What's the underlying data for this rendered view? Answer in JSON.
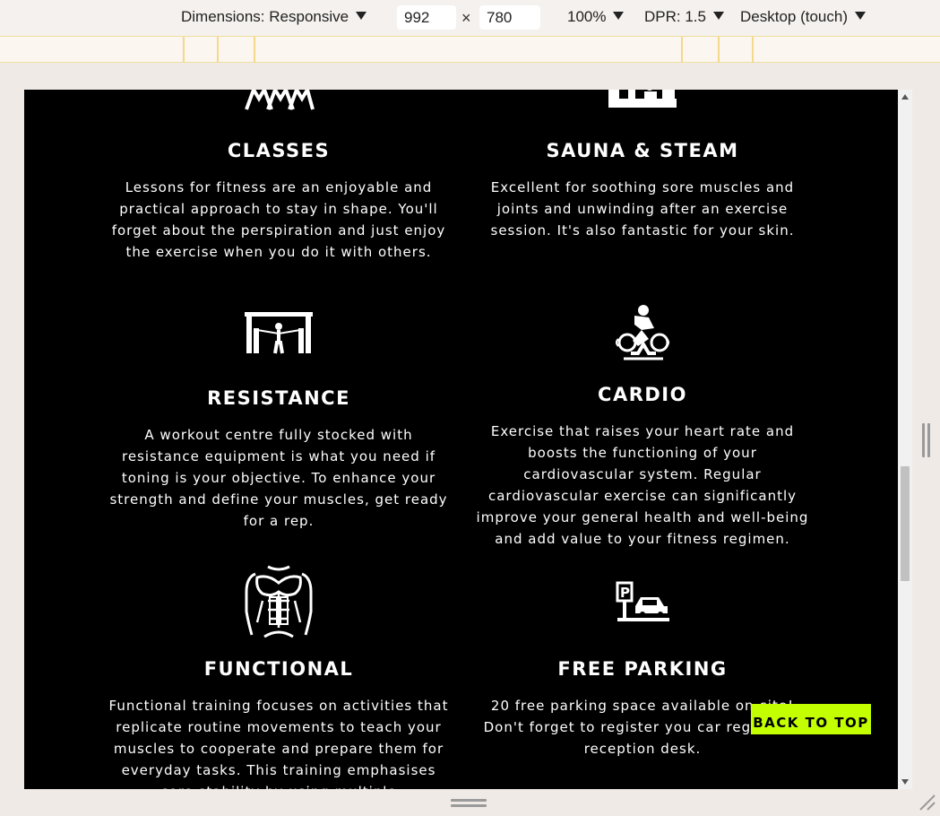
{
  "devtools": {
    "dimensions_label": "Dimensions: Responsive",
    "width_value": "992",
    "times_symbol": "×",
    "height_value": "780",
    "zoom": "100%",
    "dpr": "DPR: 1.5",
    "device_mode": "Desktop (touch)"
  },
  "features": [
    {
      "title": "CLASSES",
      "icon": "group-exercise-icon",
      "description": "Lessons for fitness are an enjoyable and practical approach to stay in shape. You'll forget about the perspiration and just enjoy the exercise when you do it with others."
    },
    {
      "title": "SAUNA & STEAM",
      "icon": "sauna-icon",
      "description": "Excellent for soothing sore muscles and joints and unwinding after an exercise session. It's also fantastic for your skin."
    },
    {
      "title": "RESISTANCE",
      "icon": "cable-machine-icon",
      "description": "A workout centre fully stocked with resistance equipment is what you need if toning is your objective. To enhance your strength and define your muscles, get ready for a rep."
    },
    {
      "title": "CARDIO",
      "icon": "exercise-bike-icon",
      "description": "Exercise that raises your heart rate and boosts the functioning of your cardiovascular system. Regular cardiovascular exercise can significantly improve your general health and well-being and add value to your fitness regimen."
    },
    {
      "title": "FUNCTIONAL",
      "icon": "torso-muscles-icon",
      "description": "Functional training focuses on activities that replicate routine movements to teach your muscles to cooperate and prepare them for everyday tasks. This training emphasises core stability by using multiple"
    },
    {
      "title": "FREE PARKING",
      "icon": "parking-car-icon",
      "description": "20 free parking space available on-site! Don't forget to register you car reg at the reception desk."
    }
  ],
  "back_to_top": "BACK TO TOP",
  "colors": {
    "accent": "#c3ff00",
    "background": "#000000",
    "text": "#ffffff"
  }
}
